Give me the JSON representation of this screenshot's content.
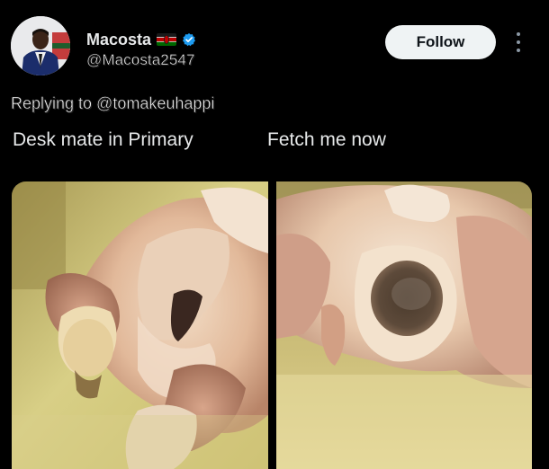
{
  "author": {
    "display_name": "Macosta",
    "handle": "@Macosta2547",
    "flag_icon": "kenya-flag-icon",
    "verified_icon": "verified-badge-icon",
    "verified_color": "#1d9bf0"
  },
  "actions": {
    "follow_label": "Follow",
    "more_icon": "more-vertical-icon"
  },
  "reply_context": {
    "text": "Replying to @tomakeuhappi"
  },
  "captions": {
    "left": "Desk mate in Primary",
    "right": "Fetch me now"
  },
  "media": {
    "images": [
      {
        "name": "photo-left",
        "subject": "raw-chicken-closeup-left"
      },
      {
        "name": "photo-right",
        "subject": "raw-chicken-closeup-right"
      }
    ]
  },
  "colors": {
    "background": "#000000",
    "text_primary": "#e7e9ea",
    "follow_bg": "#eff3f4",
    "follow_text": "#0f1419"
  }
}
